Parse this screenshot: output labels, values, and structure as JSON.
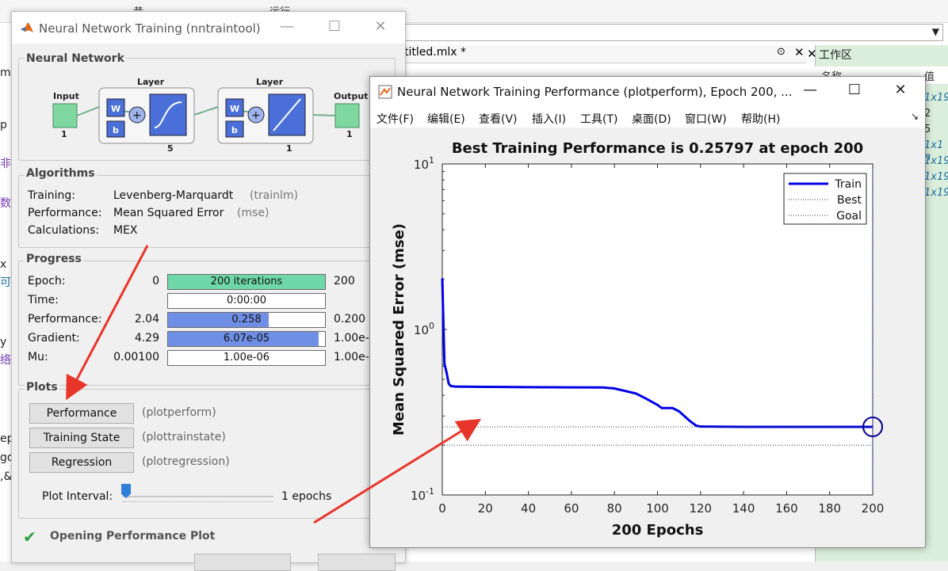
{
  "background": {
    "toolbar_items": [
      "昔",
      "运行"
    ],
    "editor_tab": "titled.mlx *",
    "workspace_title": "工作区",
    "workspace_header_name": "名称",
    "workspace_header_value": "值",
    "workspace_values": [
      "1x19",
      "2",
      "5",
      "1x1 n",
      "1x19",
      "1x19",
      "1x19"
    ],
    "left_strip_fragments": [
      "ml",
      "p",
      "非",
      "数",
      "x",
      "可",
      "y",
      "络",
      "ep",
      "go",
      ",&"
    ]
  },
  "nntraintool": {
    "title": "Neural Network Training (nntraintool)",
    "network": {
      "section_title": "Neural Network",
      "input_label": "Input",
      "input_size": "1",
      "layer1_label": "Layer",
      "layer1_size": "5",
      "layer2_label": "Layer",
      "layer2_size": "1",
      "output_label": "Output",
      "output_size": "1",
      "weight_label": "W",
      "bias_label": "b",
      "sum_label": "+"
    },
    "algorithms": {
      "section_title": "Algorithms",
      "rows": [
        {
          "label": "Training:",
          "value": "Levenberg-Marquardt",
          "fn": "(trainlm)"
        },
        {
          "label": "Performance:",
          "value": "Mean Squared Error",
          "fn": "(mse)"
        },
        {
          "label": "Calculations:",
          "value": "MEX",
          "fn": ""
        }
      ]
    },
    "progress": {
      "section_title": "Progress",
      "rows": [
        {
          "label": "Epoch:",
          "start": "0",
          "bar_text": "200 iterations",
          "end": "200",
          "fill": 1.0,
          "color": "#6fd8a8"
        },
        {
          "label": "Time:",
          "start": "",
          "bar_text": "0:00:00",
          "end": "",
          "fill": 0.0,
          "color": "#ffffff"
        },
        {
          "label": "Performance:",
          "start": "2.04",
          "bar_text": "0.258",
          "end": "0.200",
          "fill": 0.64,
          "color": "#6f8fe6"
        },
        {
          "label": "Gradient:",
          "start": "4.29",
          "bar_text": "6.07e-05",
          "end": "1.00e-",
          "fill": 0.96,
          "color": "#6f8fe6"
        },
        {
          "label": "Mu:",
          "start": "0.00100",
          "bar_text": "1.00e-06",
          "end": "1.00e-",
          "fill": 0.0,
          "color": "#ffffff"
        }
      ]
    },
    "plots": {
      "section_title": "Plots",
      "buttons": [
        {
          "label": "Performance",
          "fn": "(plotperform)"
        },
        {
          "label": "Training State",
          "fn": "(plottrainstate)"
        },
        {
          "label": "Regression",
          "fn": "(plotregression)"
        }
      ],
      "interval_label": "Plot Interval:",
      "interval_value": "1 epochs"
    },
    "status_text": "Opening Performance Plot",
    "status_color": "#2ea043"
  },
  "perf_window": {
    "title": "Neural Network Training Performance (plotperform), Epoch 200, ...",
    "menu": [
      "文件(F)",
      "编辑(E)",
      "查看(V)",
      "插入(I)",
      "工具(T)",
      "桌面(D)",
      "窗口(W)",
      "帮助(H)"
    ],
    "menu_tail_icon": "dock-arrow-icon"
  },
  "chart_data": {
    "type": "line",
    "title": "Best Training Performance is 0.25797 at epoch 200",
    "xlabel": "200 Epochs",
    "ylabel": "Mean Squared Error  (mse)",
    "xlim": [
      0,
      200
    ],
    "ylim": [
      0.1,
      10
    ],
    "yscale": "log",
    "x_ticks": [
      "0",
      "20",
      "40",
      "60",
      "80",
      "100",
      "120",
      "140",
      "160",
      "180",
      "200"
    ],
    "y_ticks": [
      {
        "base": "10",
        "exp": "1"
      },
      {
        "base": "10",
        "exp": "0"
      },
      {
        "base": "10",
        "exp": "-1"
      }
    ],
    "legend_position": "top-right",
    "series": [
      {
        "name": "Train",
        "style": "solid",
        "color": "#0000e6",
        "x": [
          0,
          1,
          2,
          3,
          4,
          6,
          10,
          20,
          40,
          60,
          75,
          80,
          90,
          95,
          100,
          102,
          105,
          107,
          110,
          115,
          118,
          120,
          140,
          160,
          180,
          200
        ],
        "y": [
          2.04,
          0.62,
          0.55,
          0.47,
          0.455,
          0.452,
          0.451,
          0.45,
          0.448,
          0.447,
          0.446,
          0.44,
          0.41,
          0.38,
          0.35,
          0.335,
          0.335,
          0.335,
          0.32,
          0.28,
          0.262,
          0.259,
          0.258,
          0.258,
          0.258,
          0.25797
        ]
      },
      {
        "name": "Best",
        "style": "dotted",
        "color": "#333333",
        "x": [
          0,
          200
        ],
        "y": [
          0.25797,
          0.25797
        ]
      },
      {
        "name": "Goal",
        "style": "dotted",
        "color": "#333333",
        "x": [
          0,
          200
        ],
        "y": [
          0.2,
          0.2
        ]
      }
    ],
    "best_marker": {
      "x": 200,
      "y": 0.25797,
      "color": "#00008b"
    }
  }
}
